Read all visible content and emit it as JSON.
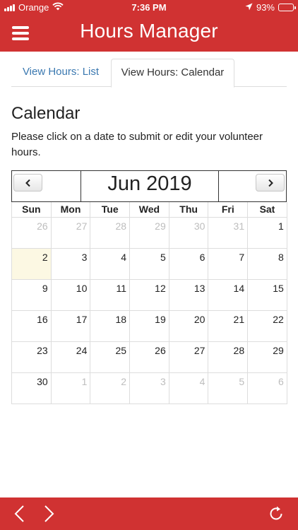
{
  "status_bar": {
    "carrier": "Orange",
    "time": "7:36 PM",
    "battery": "93%"
  },
  "app": {
    "title": "Hours Manager"
  },
  "tabs": [
    {
      "label": "View Hours: List",
      "active": false
    },
    {
      "label": "View Hours: Calendar",
      "active": true
    }
  ],
  "page": {
    "heading": "Calendar",
    "instructions": "Please click on a date to submit or edit your volunteer hours."
  },
  "calendar": {
    "month_label": "Jun 2019",
    "weekdays": [
      "Sun",
      "Mon",
      "Tue",
      "Wed",
      "Thu",
      "Fri",
      "Sat"
    ],
    "weeks": [
      [
        {
          "d": "26",
          "o": true
        },
        {
          "d": "27",
          "o": true
        },
        {
          "d": "28",
          "o": true
        },
        {
          "d": "29",
          "o": true
        },
        {
          "d": "30",
          "o": true
        },
        {
          "d": "31",
          "o": true
        },
        {
          "d": "1",
          "o": false
        }
      ],
      [
        {
          "d": "2",
          "o": false,
          "today": true
        },
        {
          "d": "3",
          "o": false
        },
        {
          "d": "4",
          "o": false
        },
        {
          "d": "5",
          "o": false
        },
        {
          "d": "6",
          "o": false
        },
        {
          "d": "7",
          "o": false
        },
        {
          "d": "8",
          "o": false
        }
      ],
      [
        {
          "d": "9",
          "o": false
        },
        {
          "d": "10",
          "o": false
        },
        {
          "d": "11",
          "o": false
        },
        {
          "d": "12",
          "o": false
        },
        {
          "d": "13",
          "o": false
        },
        {
          "d": "14",
          "o": false
        },
        {
          "d": "15",
          "o": false
        }
      ],
      [
        {
          "d": "16",
          "o": false
        },
        {
          "d": "17",
          "o": false
        },
        {
          "d": "18",
          "o": false
        },
        {
          "d": "19",
          "o": false
        },
        {
          "d": "20",
          "o": false
        },
        {
          "d": "21",
          "o": false
        },
        {
          "d": "22",
          "o": false
        }
      ],
      [
        {
          "d": "23",
          "o": false
        },
        {
          "d": "24",
          "o": false
        },
        {
          "d": "25",
          "o": false
        },
        {
          "d": "26",
          "o": false
        },
        {
          "d": "27",
          "o": false
        },
        {
          "d": "28",
          "o": false
        },
        {
          "d": "29",
          "o": false
        }
      ],
      [
        {
          "d": "30",
          "o": false
        },
        {
          "d": "1",
          "o": true
        },
        {
          "d": "2",
          "o": true
        },
        {
          "d": "3",
          "o": true
        },
        {
          "d": "4",
          "o": true
        },
        {
          "d": "5",
          "o": true
        },
        {
          "d": "6",
          "o": true
        }
      ]
    ]
  },
  "icons": {
    "menu": "hamburger-menu-icon",
    "prev": "chevron-left-icon",
    "next": "chevron-right-icon",
    "back": "back-arrow-icon",
    "forward": "forward-arrow-icon",
    "reload": "reload-icon",
    "wifi": "wifi-icon",
    "location": "location-arrow-icon",
    "battery": "battery-icon"
  },
  "colors": {
    "brand_red": "#d03232",
    "link_blue": "#3a78b0",
    "today_bg": "#fcf8e3",
    "other_month_text": "#bdbdbd"
  }
}
